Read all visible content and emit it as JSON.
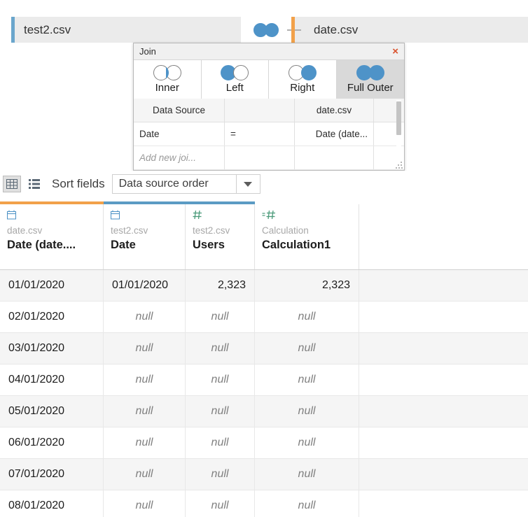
{
  "flow": {
    "left_table": "test2.csv",
    "right_table": "date.csv",
    "join_icon": "full-outer-venn-icon",
    "left_accent_color": "#6aa6cc",
    "right_accent_color": "#f2a14a"
  },
  "join_dialog": {
    "title": "Join",
    "close_label": "×",
    "types": [
      {
        "label": "Inner",
        "icon": "venn-inner-icon",
        "selected": false
      },
      {
        "label": "Left",
        "icon": "venn-left-icon",
        "selected": false
      },
      {
        "label": "Right",
        "icon": "venn-right-icon",
        "selected": false
      },
      {
        "label": "Full Outer",
        "icon": "venn-full-outer-icon",
        "selected": true
      }
    ],
    "grid": {
      "headers": [
        "Data Source",
        "",
        "date.csv",
        ""
      ],
      "rows": [
        {
          "left": "Date",
          "operator": "=",
          "right": "Date (date..."
        }
      ],
      "placeholder": "Add new joi..."
    }
  },
  "toolbar": {
    "grid_view_icon": "grid-view-icon",
    "list_view_icon": "list-view-icon",
    "sort_label": "Sort fields",
    "sort_value": "Data source order",
    "dropdown_icon": "chevron-down-icon"
  },
  "data_grid": {
    "columns": [
      {
        "source": "date.csv",
        "title": "Date (date....",
        "type_icon": "date-icon",
        "type": "date",
        "accent_color": "#f2a14a",
        "align": "left"
      },
      {
        "source": "test2.csv",
        "title": "Date",
        "type_icon": "date-icon",
        "type": "date",
        "accent_color": "#5b9bc4",
        "align": "left"
      },
      {
        "source": "test2.csv",
        "title": "Users",
        "type_icon": "number-icon",
        "type": "number",
        "accent_color": "#5b9bc4",
        "align": "right"
      },
      {
        "source": "Calculation",
        "title": "Calculation1",
        "type_icon": "calculated-number-icon",
        "type": "calculation",
        "accent_color": "",
        "align": "right"
      }
    ],
    "null_text": "null",
    "rows": [
      [
        "01/01/2020",
        "01/01/2020",
        "2,323",
        "2,323"
      ],
      [
        "02/01/2020",
        "null",
        "null",
        "null"
      ],
      [
        "03/01/2020",
        "null",
        "null",
        "null"
      ],
      [
        "04/01/2020",
        "null",
        "null",
        "null"
      ],
      [
        "05/01/2020",
        "null",
        "null",
        "null"
      ],
      [
        "06/01/2020",
        "null",
        "null",
        "null"
      ],
      [
        "07/01/2020",
        "null",
        "null",
        "null"
      ],
      [
        "08/01/2020",
        "null",
        "null",
        "null"
      ]
    ]
  }
}
